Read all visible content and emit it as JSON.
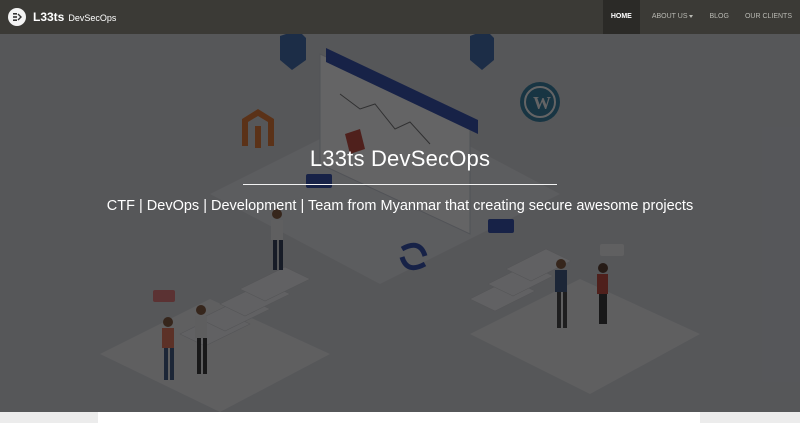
{
  "navbar": {
    "brand_name": "L33ts",
    "brand_sub": "DevSecOps",
    "links": [
      {
        "label": "HOME",
        "active": true
      },
      {
        "label": "ABOUT US",
        "has_dropdown": true
      },
      {
        "label": "BLOG"
      },
      {
        "label": "OUR CLIENTS"
      }
    ]
  },
  "hero": {
    "title": "L33ts DevSecOps",
    "subtitle": "CTF | DevOps | Development | Team from Myanmar that creating secure awesome projects"
  },
  "colors": {
    "navbar_bg": "#3b3a36",
    "active_tab_bg": "#2b2a27",
    "accent_blue": "#1f3fa8",
    "overlay": "rgba(20,20,22,0.66)"
  },
  "icons": [
    "brand-logo-icon",
    "shield-icon",
    "wordpress-icon",
    "magento-icon",
    "sync-icon",
    "chevron-down-icon"
  ]
}
